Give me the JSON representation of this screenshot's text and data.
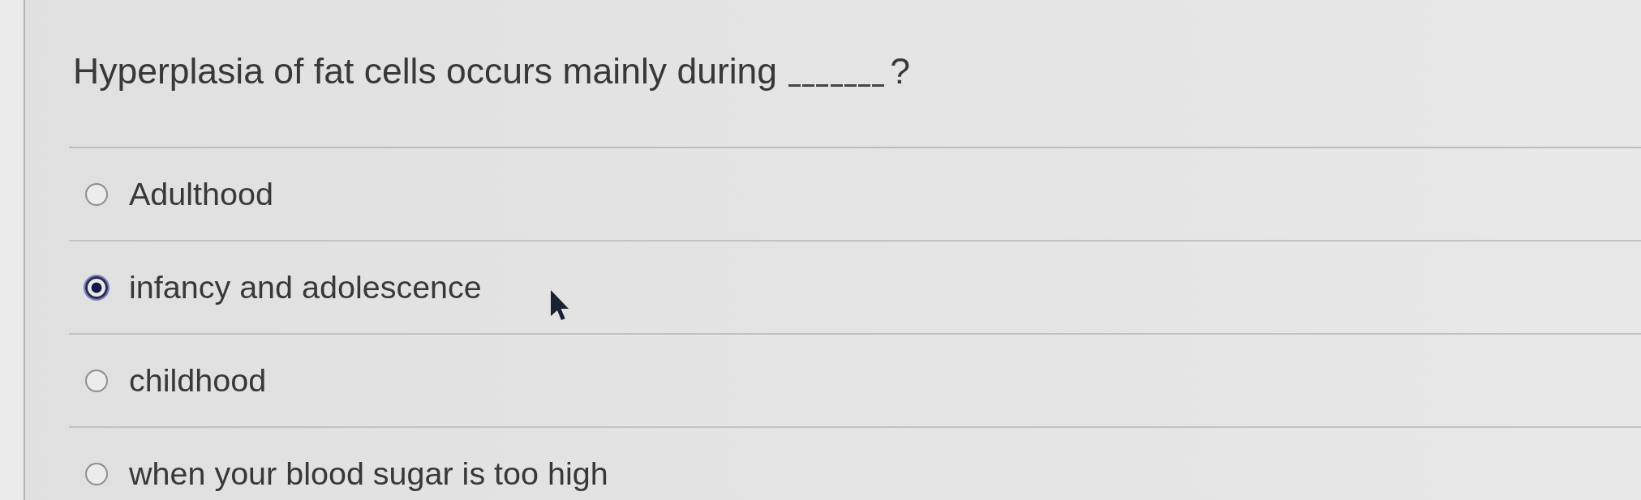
{
  "question": {
    "text": "Hyperplasia of fat cells occurs mainly during",
    "has_blank": true,
    "text_after_blank": "?"
  },
  "options": [
    {
      "label": "Adulthood",
      "selected": false
    },
    {
      "label": "infancy and adolescence",
      "selected": true
    },
    {
      "label": "childhood",
      "selected": false
    },
    {
      "label": "when your blood sugar is too high",
      "selected": false
    }
  ]
}
